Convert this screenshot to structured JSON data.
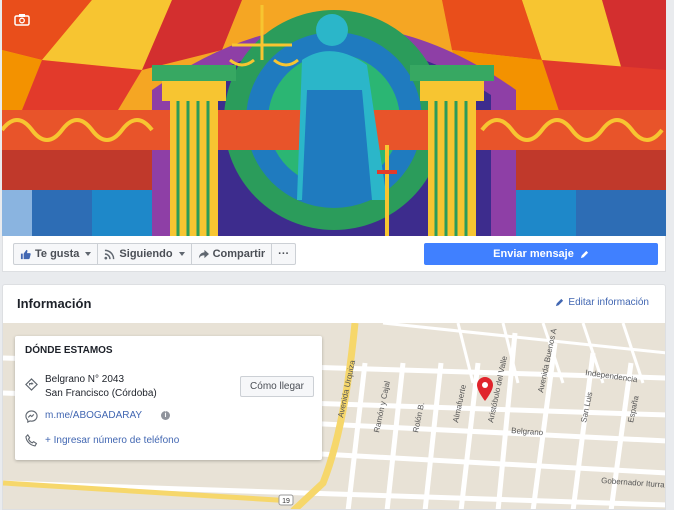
{
  "actions": {
    "like": "Te gusta",
    "following": "Siguiendo",
    "share": "Compartir",
    "more": "···",
    "send_message": "Enviar mensaje"
  },
  "info": {
    "title": "Información",
    "edit_link": "Editar información"
  },
  "where": {
    "title": "DÓNDE ESTAMOS",
    "address_line1": "Belgrano N° 2043",
    "address_line2": "San Francisco (Córdoba)",
    "directions_button": "Cómo llegar",
    "messenger_link": "m.me/ABOGADARAY",
    "add_phone": "+ Ingresar número de teléfono"
  },
  "map": {
    "streets": [
      "Avenida Urquiza",
      "Ramón y Cajal",
      "Rolón B.",
      "Almafuerte",
      "Aristóbulo del Valle",
      "Avenida Buenos A",
      "Independencia",
      "San Luis",
      "España",
      "Belgrano",
      "Gobernador Iturra",
      "19"
    ]
  },
  "colors": {
    "accent": "#4080ff",
    "link": "#4267b2",
    "pin": "#e0242c"
  }
}
